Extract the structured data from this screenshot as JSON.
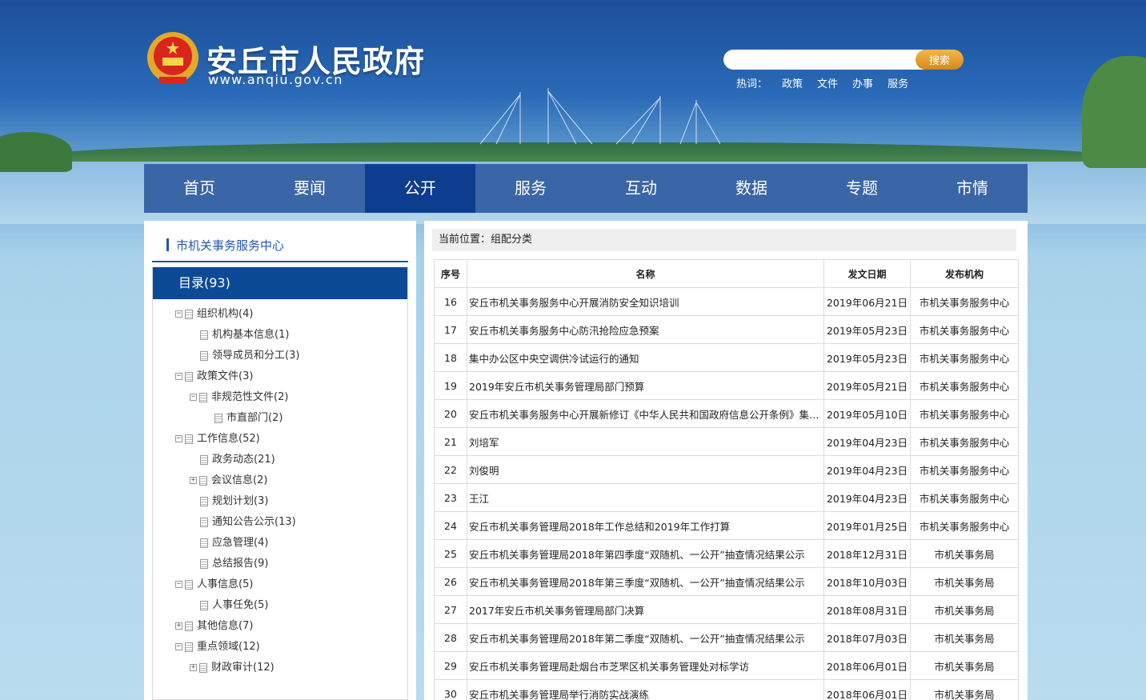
{
  "site": {
    "title": "安丘市人民政府",
    "url": "www.anqiu.gov.cn"
  },
  "search": {
    "placeholder": "",
    "button": "搜索",
    "hot_label": "热词：",
    "hot_words": [
      "政策",
      "文件",
      "办事",
      "服务"
    ]
  },
  "nav": {
    "items": [
      "首页",
      "要闻",
      "公开",
      "服务",
      "互动",
      "数据",
      "专题",
      "市情"
    ],
    "active": "公开"
  },
  "sidebar": {
    "heading": "市机关事务服务中心",
    "root": "目录(93)",
    "nodes": [
      {
        "label": "组织机构(4)",
        "toggle": "−"
      },
      {
        "label": "机构基本信息(1)",
        "toggle": ""
      },
      {
        "label": "领导成员和分工(3)",
        "toggle": ""
      },
      {
        "label": "政策文件(3)",
        "toggle": "−"
      },
      {
        "label": "非规范性文件(2)",
        "toggle": "−"
      },
      {
        "label": "市直部门(2)",
        "toggle": ""
      },
      {
        "label": "工作信息(52)",
        "toggle": "−"
      },
      {
        "label": "政务动态(21)",
        "toggle": ""
      },
      {
        "label": "会议信息(2)",
        "toggle": "+"
      },
      {
        "label": "规划计划(3)",
        "toggle": ""
      },
      {
        "label": "通知公告公示(13)",
        "toggle": ""
      },
      {
        "label": "应急管理(4)",
        "toggle": ""
      },
      {
        "label": "总结报告(9)",
        "toggle": ""
      },
      {
        "label": "人事信息(5)",
        "toggle": "−"
      },
      {
        "label": "人事任免(5)",
        "toggle": ""
      },
      {
        "label": "其他信息(7)",
        "toggle": "+"
      },
      {
        "label": "重点领域(12)",
        "toggle": "−"
      },
      {
        "label": "财政审计(12)",
        "toggle": "+"
      }
    ]
  },
  "content": {
    "breadcrumb": "当前位置：组配分类",
    "columns": [
      "序号",
      "名称",
      "发文日期",
      "发布机构"
    ],
    "rows": [
      [
        "16",
        "安丘市机关事务服务中心开展消防安全知识培训",
        "2019年06月21日",
        "市机关事务服务中心"
      ],
      [
        "17",
        "安丘市机关事务服务中心防汛抢险应急预案",
        "2019年05月23日",
        "市机关事务服务中心"
      ],
      [
        "18",
        "集中办公区中央空调供冷试运行的通知",
        "2019年05月23日",
        "市机关事务服务中心"
      ],
      [
        "19",
        "2019年安丘市机关事务管理局部门预算",
        "2019年05月21日",
        "市机关事务服务中心"
      ],
      [
        "20",
        "安丘市机关事务服务中心开展新修订《中华人民共和国政府信息公开条例》集中...",
        "2019年05月10日",
        "市机关事务服务中心"
      ],
      [
        "21",
        "刘培军",
        "2019年04月23日",
        "市机关事务服务中心"
      ],
      [
        "22",
        "刘俊明",
        "2019年04月23日",
        "市机关事务服务中心"
      ],
      [
        "23",
        "王江",
        "2019年04月23日",
        "市机关事务服务中心"
      ],
      [
        "24",
        "安丘市机关事务管理局2018年工作总结和2019年工作打算",
        "2019年01月25日",
        "市机关事务服务中心"
      ],
      [
        "25",
        "安丘市机关事务管理局2018年第四季度“双随机、一公开”抽查情况结果公示",
        "2018年12月31日",
        "市机关事务局"
      ],
      [
        "26",
        "安丘市机关事务管理局2018年第三季度“双随机、一公开”抽查情况结果公示",
        "2018年10月03日",
        "市机关事务局"
      ],
      [
        "27",
        "2017年安丘市机关事务管理局部门决算",
        "2018年08月31日",
        "市机关事务局"
      ],
      [
        "28",
        "安丘市机关事务管理局2018年第二季度“双随机、一公开”抽查情况结果公示",
        "2018年07月03日",
        "市机关事务局"
      ],
      [
        "29",
        "安丘市机关事务管理局赴烟台市芝罘区机关事务管理处对标学访",
        "2018年06月01日",
        "市机关事务局"
      ],
      [
        "30",
        "安丘市机关事务管理局举行消防实战演练",
        "2018年06月01日",
        "市机关事务局"
      ]
    ]
  },
  "colors": {
    "nav_bg": "#3a65a7",
    "nav_active": "#0d3d8e",
    "accent": "#1f58a8",
    "search_btn": "#e29a2a"
  }
}
